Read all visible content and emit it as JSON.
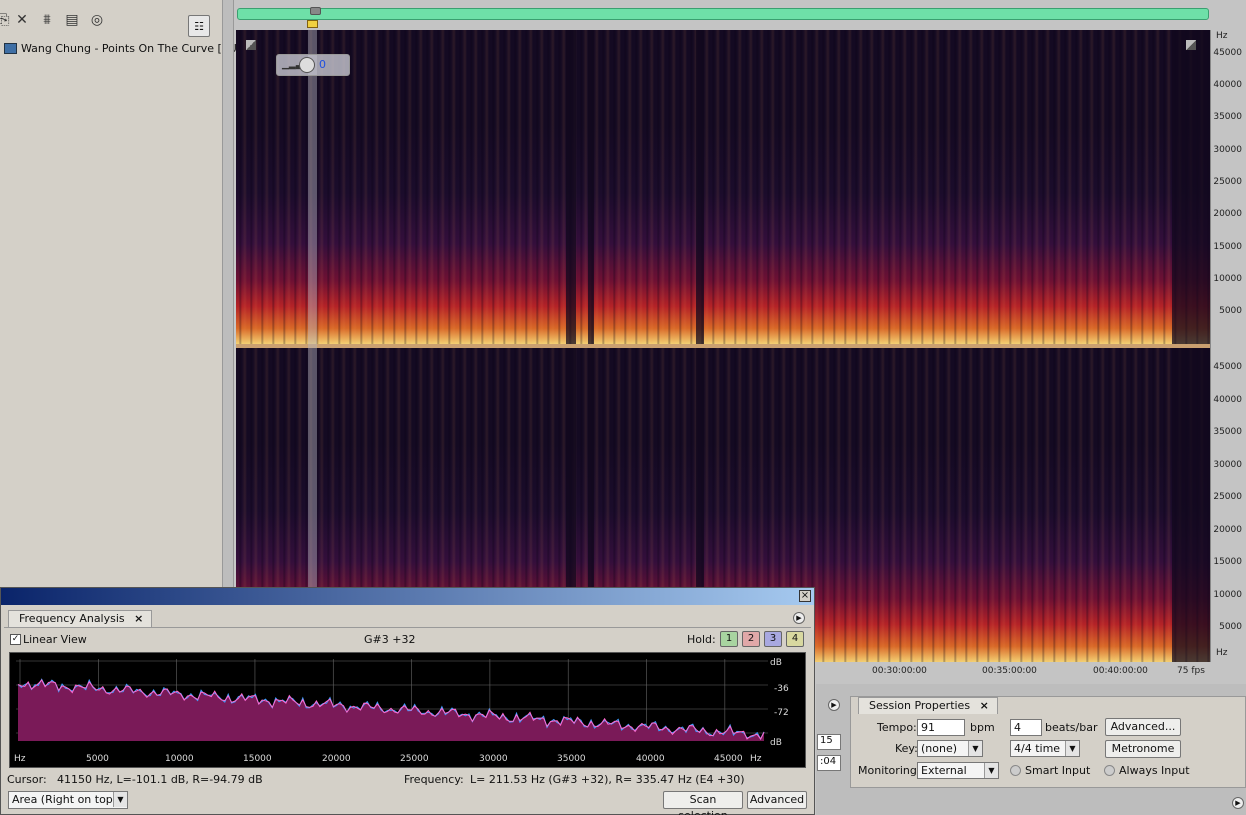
{
  "files": {
    "item_label": "Wang Chung - Points On The Curve [EU]."
  },
  "spectral": {
    "hud_value": "0",
    "hz_unit": "Hz",
    "top_hz_ticks": [
      "45000",
      "40000",
      "35000",
      "30000",
      "25000",
      "20000",
      "15000",
      "10000",
      "5000"
    ],
    "bottom_hz_ticks": [
      "45000",
      "40000",
      "35000",
      "30000",
      "25000",
      "20000",
      "15000",
      "10000",
      "5000"
    ],
    "time_ticks": [
      "00:30:00:00",
      "00:35:00:00",
      "00:40:00:00"
    ],
    "fps": "75 fps",
    "colors": {
      "background": "#160c22",
      "low_band": "#ffd878",
      "mid_band": "#e03a30",
      "high_band": "#5a1a5a",
      "channel_separator": "#caa070"
    }
  },
  "time_fields": [
    "15",
    ":04"
  ],
  "session": {
    "tab_label": "Session Properties",
    "tab_close": "×",
    "tempo_label": "Tempo:",
    "tempo_value": "91",
    "bpm_label": "bpm",
    "beats_value": "4",
    "beats_label": "beats/bar",
    "advanced_button": "Advanced...",
    "key_label": "Key:",
    "key_value": "(none)",
    "time_sig_value": "4/4 time",
    "metronome_button": "Metronome",
    "monitoring_label": "Monitoring:",
    "monitoring_value": "External",
    "smart_input_label": "Smart Input",
    "always_input_label": "Always Input"
  },
  "frequency_analysis": {
    "tab_label": "Frequency Analysis",
    "tab_close": "×",
    "window_close": "×",
    "linear_view_label": "Linear View",
    "linear_view_checked": true,
    "note_readout": "G#3 +32",
    "hold_label": "Hold:",
    "hold_buttons": [
      {
        "label": "1",
        "color": "#a8d4a0"
      },
      {
        "label": "2",
        "color": "#e0a8a8"
      },
      {
        "label": "3",
        "color": "#a8a8e0"
      },
      {
        "label": "4",
        "color": "#d8d8a0"
      }
    ],
    "x_ticks": [
      "Hz",
      "5000",
      "10000",
      "15000",
      "20000",
      "25000",
      "30000",
      "35000",
      "40000",
      "45000",
      "Hz"
    ],
    "db_ticks": [
      "dB",
      "-36",
      "-72",
      "dB"
    ],
    "cursor_label": "Cursor:",
    "cursor_value": "41150 Hz, L=-101.1 dB, R=-94.79 dB",
    "frequency_label": "Frequency:",
    "frequency_value": "L= 211.53 Hz (G#3 +32), R= 335.47 Hz (E4 +30)",
    "view_mode": "Area (Right on top)",
    "scan_button": "Scan selection",
    "advanced_button": "Advanced",
    "colors": {
      "fill": "#7a1a58",
      "left_line": "#3fa0ff",
      "right_line": "#ff6ad0",
      "grid": "#666666"
    }
  }
}
